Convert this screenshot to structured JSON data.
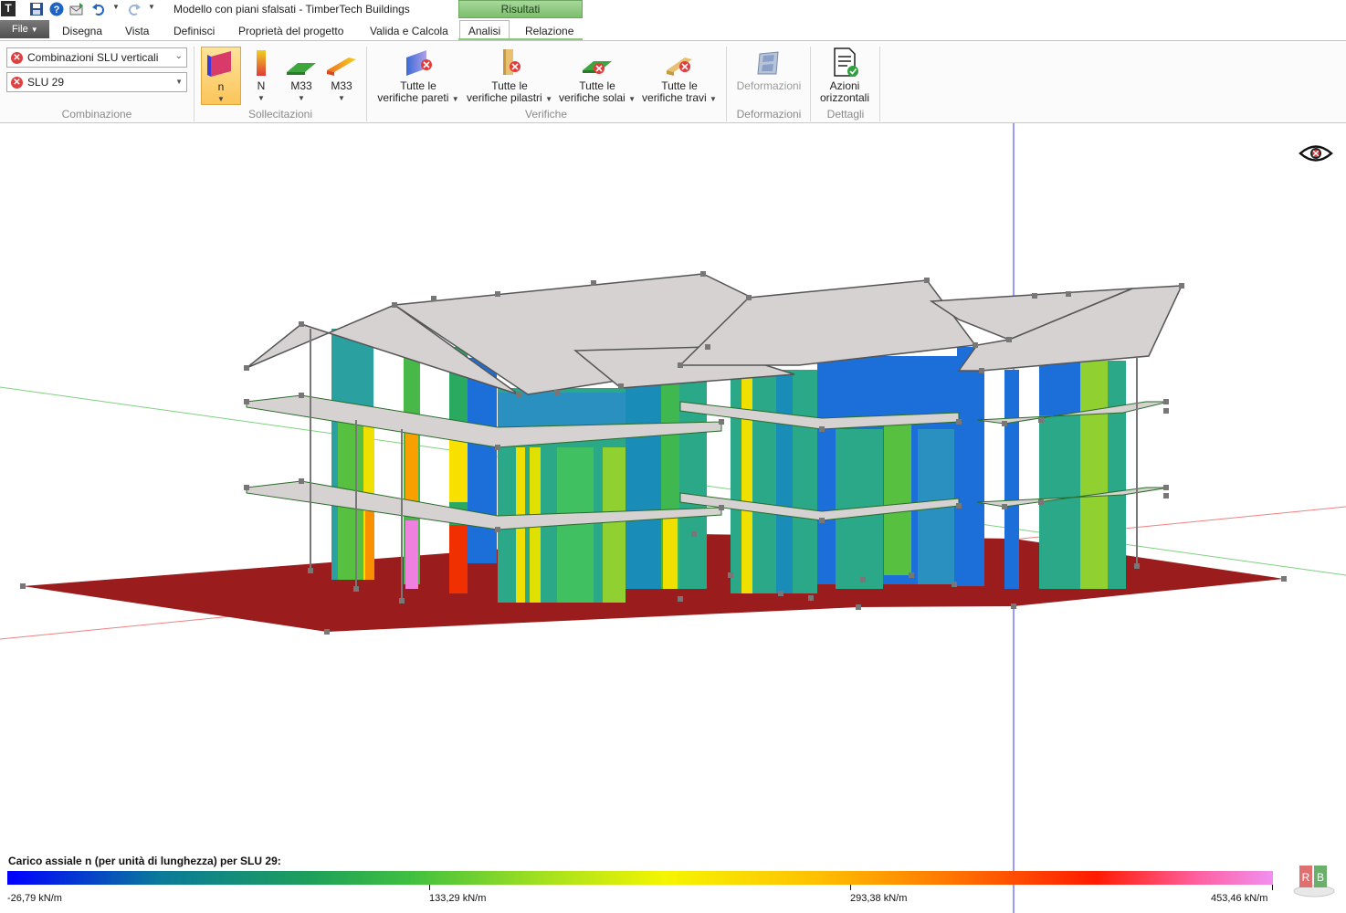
{
  "window": {
    "title": "Modello con piani sfalsati - TimberTech Buildings",
    "context_tab": "Risultati"
  },
  "quick_access": [
    "app-icon",
    "save-icon",
    "help-icon",
    "publish-icon",
    "undo-icon",
    "redo-icon"
  ],
  "tabs": {
    "file": "File",
    "items": [
      {
        "label": "Disegna"
      },
      {
        "label": "Vista"
      },
      {
        "label": "Definisci"
      },
      {
        "label": "Proprietà del progetto"
      },
      {
        "label": "Valida e Calcola"
      },
      {
        "label": "Analisi"
      },
      {
        "label": "Relazione"
      }
    ],
    "active": "Analisi"
  },
  "ribbon": {
    "combinazione": {
      "combo_type": "Combinazioni SLU verticali",
      "combo_value": "SLU 29",
      "group_label": "Combinazione"
    },
    "sollecitazioni": {
      "buttons": [
        {
          "label": "n",
          "selected": true
        },
        {
          "label": "N",
          "selected": false
        },
        {
          "label": "M33",
          "selected": false
        },
        {
          "label": "M33",
          "selected": false
        }
      ],
      "group_label": "Sollecitazioni"
    },
    "verifiche": {
      "buttons": [
        {
          "line1": "Tutte le",
          "line2": "verifiche pareti"
        },
        {
          "line1": "Tutte le",
          "line2": "verifiche pilastri"
        },
        {
          "line1": "Tutte le",
          "line2": "verifiche solai"
        },
        {
          "line1": "Tutte le",
          "line2": "verifiche travi"
        }
      ],
      "group_label": "Verifiche"
    },
    "deformazioni": {
      "button": "Deformazioni",
      "group_label": "Deformazioni"
    },
    "dettagli": {
      "line1": "Azioni",
      "line2": "orizzontali",
      "group_label": "Dettagli"
    }
  },
  "legend": {
    "title": "Carico assiale n (per unità di lunghezza) per SLU 29:",
    "ticks": [
      "-26,79 kN/m",
      "133,29 kN/m",
      "293,38 kN/m",
      "453,46 kN/m"
    ],
    "colors": {
      "min": "#0000ff",
      "mid": "#f5f500",
      "max": "#f090f0"
    }
  },
  "colors": {
    "ground": "#9b1c1c",
    "slab": "#d6d2d2",
    "context_tab": "#8cc97c"
  }
}
